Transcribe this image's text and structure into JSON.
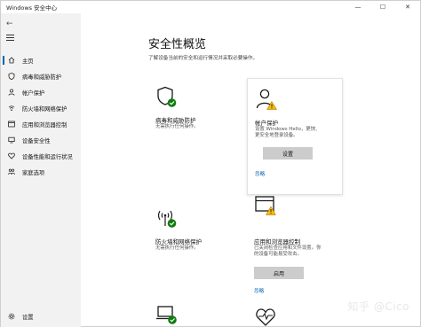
{
  "window": {
    "title": "Windows 安全中心",
    "buttons": {
      "minimize": "—",
      "maximize": "☐",
      "close": "✕"
    }
  },
  "sidebar": {
    "back_icon": "←",
    "items": [
      {
        "label": "主页",
        "icon": "home-icon",
        "active": true
      },
      {
        "label": "病毒和威胁防护",
        "icon": "shield-icon",
        "active": false
      },
      {
        "label": "帐户保护",
        "icon": "person-icon",
        "active": false
      },
      {
        "label": "防火墙和网络保护",
        "icon": "wifi-icon",
        "active": false
      },
      {
        "label": "应用和浏览器控制",
        "icon": "browser-icon",
        "active": false
      },
      {
        "label": "设备安全性",
        "icon": "device-icon",
        "active": false
      },
      {
        "label": "设备性能和运行状况",
        "icon": "heart-icon",
        "active": false
      },
      {
        "label": "家庭选项",
        "icon": "family-icon",
        "active": false
      }
    ],
    "settings_label": "设置"
  },
  "main": {
    "title": "安全性概览",
    "subtitle": "了解设备当前的安全和运行情况并采取必要操作。",
    "cards": {
      "virus": {
        "title": "病毒和威胁防护",
        "desc": "无需执行任何操作。"
      },
      "account": {
        "title": "帐户保护",
        "desc_lines": [
          "设置 Windows Hello，更快、",
          "更安全地登录设备。"
        ],
        "button": "设置",
        "link": "忽略"
      },
      "firewall": {
        "title": "防火墙和网络保护",
        "desc": "无需执行任何操作。"
      },
      "app": {
        "title": "应用和浏览器控制",
        "desc_lines": [
          "已关闭检查应用和文件设置。你",
          "的设备可能易受攻击。"
        ],
        "button": "启用",
        "link": "忽略"
      }
    }
  },
  "watermark": "知乎 @Cico",
  "colors": {
    "accent": "#0063b1",
    "ok_green": "#107c10",
    "warn_yellow": "#ffb900",
    "sidebar_bg": "#f2f2f2"
  }
}
